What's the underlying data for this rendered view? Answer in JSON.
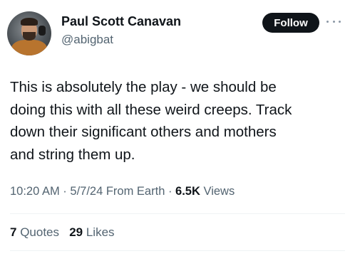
{
  "author": {
    "name": "Paul Scott Canavan",
    "handle": "@abigbat"
  },
  "actions": {
    "follow_label": "Follow"
  },
  "icons": {
    "more": "more-horizontal-icon",
    "avatar": "profile-photo"
  },
  "tweet": {
    "text": "This is absolutely the play - we should be\ndoing this with all these weird creeps. Track\ndown their significant others and mothers\nand string them up."
  },
  "meta": {
    "time": "10:20 AM",
    "sep1": " · ",
    "date": "5/7/24",
    "source": " From Earth",
    "sep2": " · ",
    "views_count": "6.5K",
    "views_label": " Views"
  },
  "stats": {
    "quotes_count": "7",
    "quotes_label": " Quotes",
    "likes_count": "29",
    "likes_label": " Likes"
  },
  "colors": {
    "text_primary": "#0f1419",
    "text_secondary": "#536471",
    "button_bg": "#0f1419",
    "divider": "#eff3f4"
  }
}
